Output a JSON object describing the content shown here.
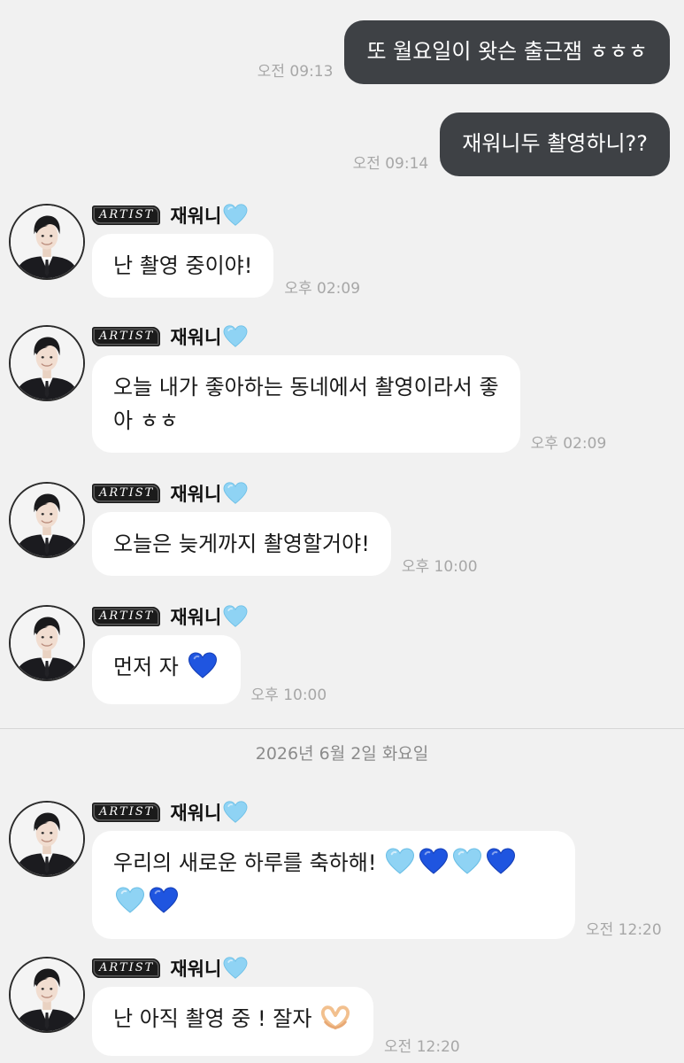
{
  "badge_label": "ARTIST",
  "sender_name": "재워니",
  "outgoing": [
    {
      "text": "또 월요일이 왓슨 출근잼 ㅎㅎㅎ",
      "time": "오전 09:13"
    },
    {
      "text": "재워니두 촬영하니??",
      "time": "오전 09:14"
    }
  ],
  "incoming": [
    {
      "line1": "난 촬영 중이야!",
      "line2": "",
      "time": "오후 02:09"
    },
    {
      "line1": "오늘 내가 좋아하는 동네에서 촬영이라서 좋",
      "line2": "아 ㅎㅎ",
      "time": "오후 02:09"
    },
    {
      "line1": "오늘은 늦게까지 촬영할거야!",
      "line2": "",
      "time": "오후 10:00"
    },
    {
      "line1": "먼저 자",
      "line2": "",
      "time": "오후 10:00"
    },
    {
      "line1": "우리의 새로운 하루를 축하해!",
      "line2": "",
      "time": "오전 12:20"
    },
    {
      "line1": "난 아직 촬영 중 ! 잘자",
      "line2": "",
      "time": "오전 12:20"
    }
  ],
  "date_separator": "2026년 6월 2일 화요일",
  "colors": {
    "background": "#f1f1f1",
    "outgoing_bubble": "#3e4145",
    "incoming_bubble": "#ffffff",
    "light_blue_heart": "#8fd3f4",
    "blue_heart": "#1f55e0"
  },
  "icons": [
    "light-blue-heart-icon",
    "blue-heart-icon",
    "heart-hands-icon",
    "profile-avatar"
  ]
}
